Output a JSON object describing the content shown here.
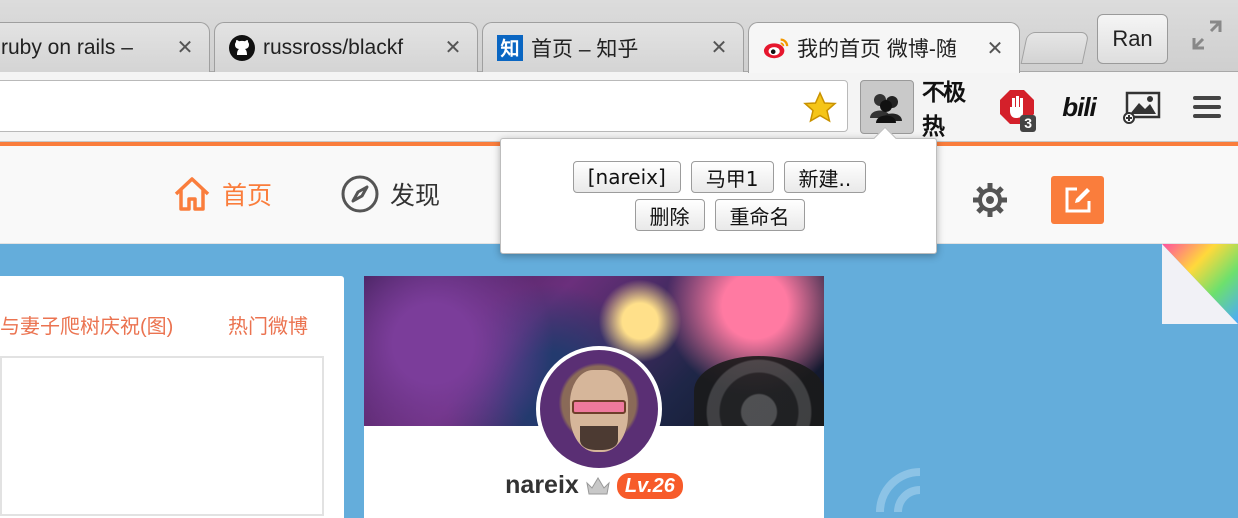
{
  "tabs": [
    {
      "title": "ruby on rails – ",
      "favicon": "none"
    },
    {
      "title": "russross/blackf",
      "favicon": "github-icon"
    },
    {
      "title": "首页 – 知乎",
      "favicon": "zhihu-icon"
    },
    {
      "title": "我的首页 微博-随",
      "favicon": "weibo-icon"
    }
  ],
  "profile_button": "Ran",
  "close_glyph": "✕",
  "toolbar": {
    "omnibox_value": "",
    "ext_hot_label": "不极热",
    "adblock_badge": "3",
    "bili_label": "bili"
  },
  "popup": {
    "accounts": [
      "[nareix]",
      "马甲1",
      "新建.."
    ],
    "actions": [
      "删除",
      "重命名"
    ]
  },
  "weibo_nav": {
    "home": "首页",
    "discover": "发现"
  },
  "feed": {
    "hot_headline": "与妻子爬树庆祝(图)",
    "hot_weibo": "热门微博"
  },
  "profile": {
    "username": "nareix",
    "level": "Lv.26"
  },
  "colors": {
    "weibo_orange": "#fa7d3c",
    "page_blue": "#64addb",
    "link_orange": "#eb7350",
    "level_red": "#f75b2a"
  }
}
